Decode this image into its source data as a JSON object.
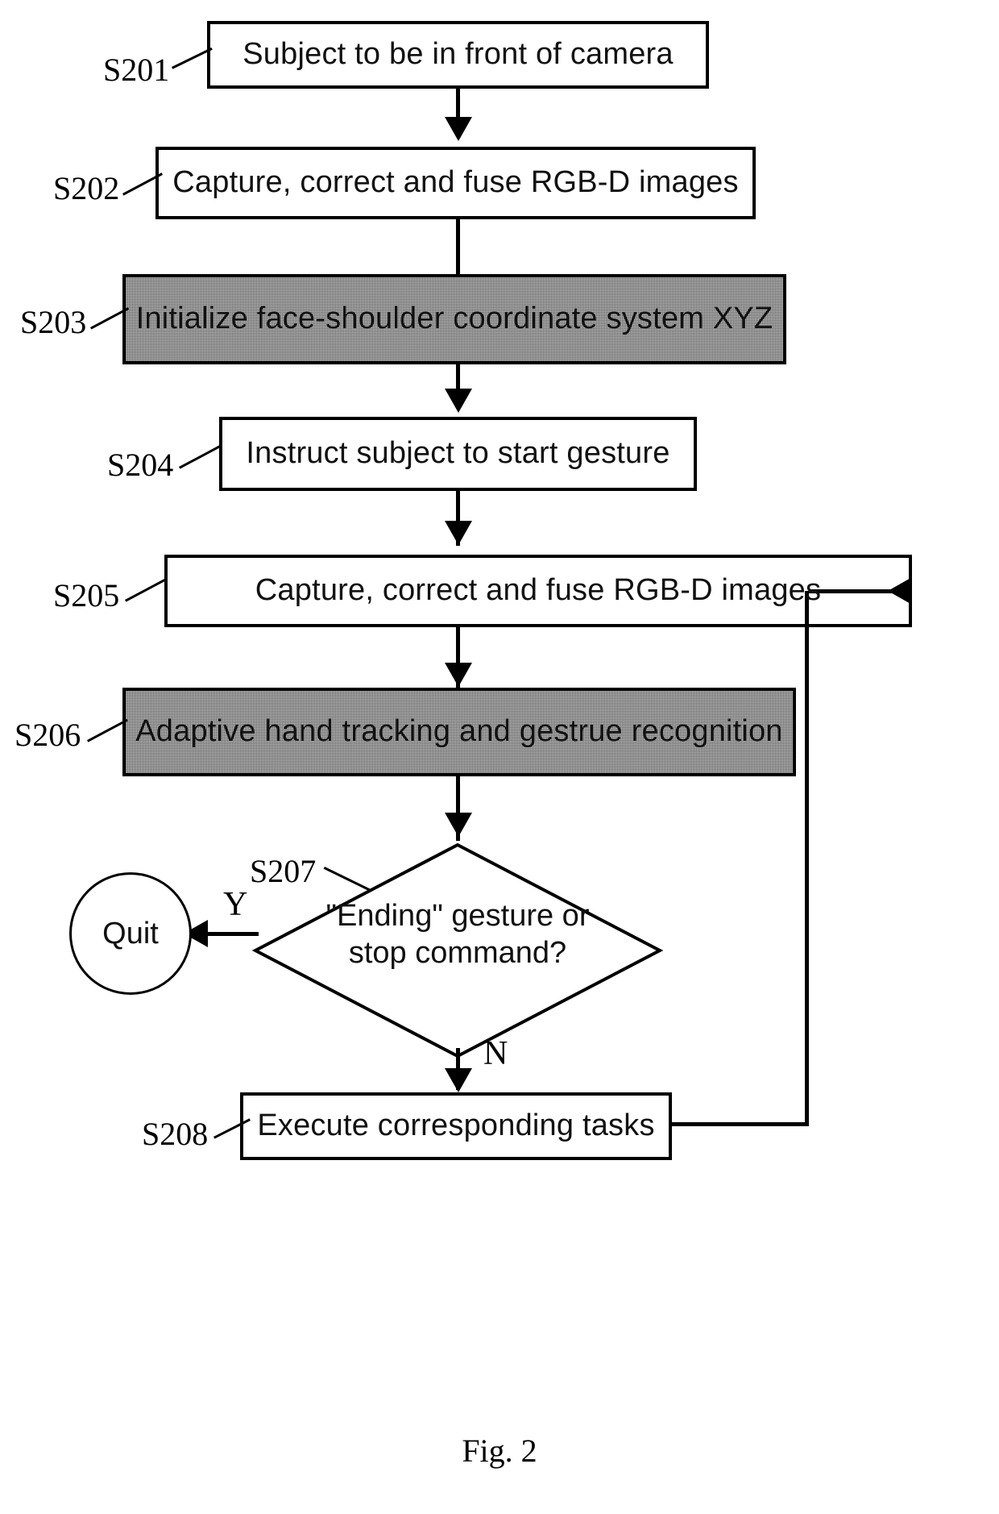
{
  "figure": {
    "caption": "Fig. 2",
    "type": "flowchart"
  },
  "steps": {
    "s201": {
      "tag": "S201",
      "text": "Subject to be in front of camera",
      "shape": "process",
      "shaded": false
    },
    "s202": {
      "tag": "S202",
      "text": "Capture, correct and fuse RGB-D images",
      "shape": "process",
      "shaded": false
    },
    "s203": {
      "tag": "S203",
      "text": "Initialize face-shoulder coordinate system XYZ",
      "shape": "process",
      "shaded": true
    },
    "s204": {
      "tag": "S204",
      "text": "Instruct subject to start gesture",
      "shape": "process",
      "shaded": false
    },
    "s205": {
      "tag": "S205",
      "text": "Capture, correct and fuse RGB-D images",
      "shape": "process",
      "shaded": false
    },
    "s206": {
      "tag": "S206",
      "text": "Adaptive hand tracking and gestrue recognition",
      "shape": "process",
      "shaded": true
    },
    "s207": {
      "tag": "S207",
      "text_line1": "\"Ending\" gesture or",
      "text_line2": "stop command?",
      "shape": "decision",
      "shaded": false
    },
    "s208": {
      "tag": "S208",
      "text": "Execute corresponding tasks",
      "shape": "process",
      "shaded": false
    }
  },
  "terminator": {
    "quit_label": "Quit"
  },
  "branches": {
    "yes_label": "Y",
    "no_label": "N"
  },
  "colors": {
    "stroke": "#000000",
    "box_fill": "#ffffff",
    "shaded_fill": "#c9c9c9",
    "text": "#111111",
    "background": "#ffffff"
  }
}
